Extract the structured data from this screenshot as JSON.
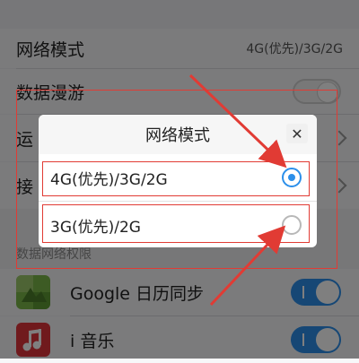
{
  "settings": {
    "network_mode_label": "网络模式",
    "network_mode_value": "4G(优先)/3G/2G",
    "roaming_label": "数据漫游",
    "carrier_label_partial": "运",
    "access_label_partial": "接",
    "section_label": "数据网络权限"
  },
  "apps": [
    {
      "name": "Google 日历同步",
      "icon": "google-calendar-icon",
      "enabled": true
    },
    {
      "name": "i 音乐",
      "icon": "music-icon",
      "enabled": true
    }
  ],
  "dialog": {
    "title": "网络模式",
    "close_glyph": "✕",
    "options": [
      {
        "label": "4G(优先)/3G/2G",
        "selected": true
      },
      {
        "label": "3G(优先)/2G",
        "selected": false
      }
    ]
  },
  "colors": {
    "accent": "#2c8fea",
    "annotation": "#e13b34",
    "music_icon": "#e0353b"
  }
}
